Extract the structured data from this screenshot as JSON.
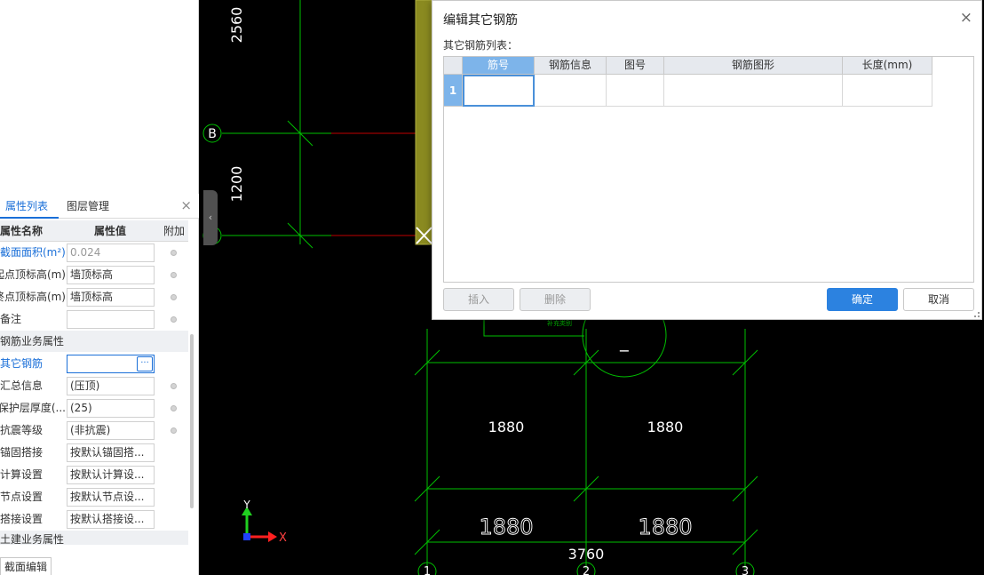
{
  "property_panel": {
    "tabs": [
      {
        "label": "属性列表",
        "active": true
      },
      {
        "label": "图层管理",
        "active": false
      }
    ],
    "header": {
      "name": "属性名称",
      "value": "属性值",
      "extra": "附加"
    },
    "rows": [
      {
        "name": "截面面积(m²)",
        "value": "0.024",
        "blue": true,
        "gray": true,
        "dot": true
      },
      {
        "name": "起点顶标高(m)",
        "value": "墙顶标高",
        "dot": true
      },
      {
        "name": "终点顶标高(m)",
        "value": "墙顶标高",
        "dot": true
      },
      {
        "name": "备注",
        "value": "",
        "dot": true
      },
      {
        "name": "钢筋业务属性",
        "group": true
      },
      {
        "name": "其它钢筋",
        "value": "",
        "blue": true,
        "active": true,
        "button": "···"
      },
      {
        "name": "汇总信息",
        "value": "(压顶)",
        "dot": true
      },
      {
        "name": "保护层厚度(...",
        "value": "(25)",
        "dot": true
      },
      {
        "name": "抗震等级",
        "value": "(非抗震)",
        "dot": true
      },
      {
        "name": "锚固搭接",
        "value": "按默认锚固搭..."
      },
      {
        "name": "计算设置",
        "value": "按默认计算设..."
      },
      {
        "name": "节点设置",
        "value": "按默认节点设..."
      },
      {
        "name": "搭接设置",
        "value": "按默认搭接设..."
      },
      {
        "name": "土建业务属性",
        "group": true
      }
    ],
    "bottom_tab": "截面编辑"
  },
  "canvas": {
    "dimensions": {
      "d2560": "2560",
      "d1200": "1200",
      "d1880a": "1880",
      "d1880b": "1880",
      "d1880c": "1880",
      "d1880d": "1880",
      "d3760": "3760",
      "dash": "−"
    },
    "axes": {
      "b": "B",
      "a": "A",
      "n1": "1",
      "n2": "2",
      "n3": "3"
    },
    "coord": {
      "x": "X",
      "y": "Y"
    },
    "note": "补充类别",
    "colors": {
      "grid": "#00d000",
      "red": "#d00000",
      "wall": "#8a8a20",
      "x_axis": "#ff2020",
      "y_axis": "#20ff20"
    }
  },
  "dialog": {
    "title": "编辑其它钢筋",
    "close": "×",
    "list_label": "其它钢筋列表：",
    "columns": [
      "筋号",
      "钢筋信息",
      "图号",
      "钢筋图形",
      "长度(mm)"
    ],
    "rows": [
      {
        "num": "1",
        "cells": [
          "",
          "",
          "",
          "",
          ""
        ]
      }
    ],
    "buttons": {
      "insert": "插入",
      "delete": "删除",
      "ok": "确定",
      "cancel": "取消"
    }
  }
}
